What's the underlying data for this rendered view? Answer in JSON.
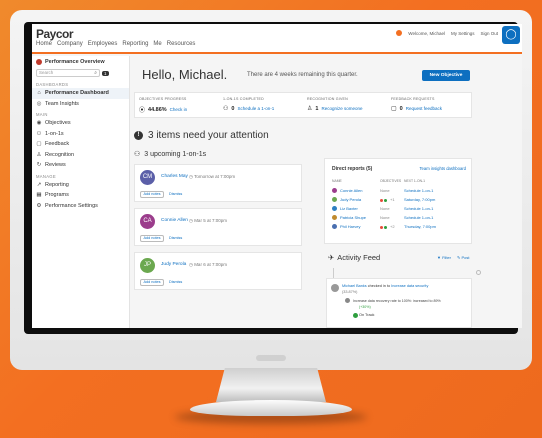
{
  "colors": {
    "brand": "#f36f21",
    "primary": "#0d6fc0",
    "on_track": "#2e9e3e"
  },
  "header": {
    "logo": "Paycor",
    "nav": [
      "Home",
      "Company",
      "Employees",
      "Reporting",
      "Me",
      "Resources"
    ],
    "welcome": "Welcome, Michael",
    "my_settings": "My Settings",
    "sign_out": "Sign Out"
  },
  "sidebar": {
    "app_title": "Performance Overview",
    "search_placeholder": "Search",
    "badge": "1",
    "sections": {
      "dashboards": "DASHBOARDS",
      "main": "MAIN",
      "manage": "MANAGE"
    },
    "items": [
      {
        "label": "Performance Dashboard",
        "icon": "home-icon"
      },
      {
        "label": "Team Insights",
        "icon": "compass-icon"
      },
      {
        "label": "Objectives",
        "icon": "target-icon"
      },
      {
        "label": "1-on-1s",
        "icon": "people-icon"
      },
      {
        "label": "Feedback",
        "icon": "chat-icon"
      },
      {
        "label": "Recognition",
        "icon": "award-icon"
      },
      {
        "label": "Reviews",
        "icon": "review-icon"
      },
      {
        "label": "Reporting",
        "icon": "chart-icon"
      },
      {
        "label": "Programs",
        "icon": "calendar-icon"
      },
      {
        "label": "Performance Settings",
        "icon": "gear-icon"
      }
    ]
  },
  "main": {
    "greeting": "Hello, Michael.",
    "subtitle": "There are 4 weeks remaining this quarter.",
    "new_objective": "New Objective",
    "stats": [
      {
        "label": "OBJECTIVES PROGRESS",
        "value": "44.86%",
        "link": "Check in"
      },
      {
        "label": "1-ON-1S COMPLETED",
        "value": "0",
        "link": "Schedule a 1-on-1"
      },
      {
        "label": "RECOGNITION GIVEN",
        "value": "1",
        "link": "Recognize someone"
      },
      {
        "label": "FEEDBACK REQUESTS",
        "value": "0",
        "link": "Request feedback"
      }
    ],
    "attention": "3 items need your attention",
    "attention_icon": "!",
    "upcoming": "3 upcoming 1-on-1s",
    "oneons": [
      {
        "initials": "CM",
        "color": "#5b5fa8",
        "name": "Charles May",
        "time": "Tomorrow at 7:00pm",
        "add_notes": "Add notes",
        "dismiss": "Dismiss"
      },
      {
        "initials": "CA",
        "color": "#9b3d8c",
        "name": "Connie Allen",
        "time": "Mar 5 at 7:00pm",
        "add_notes": "Add notes",
        "dismiss": "Dismiss"
      },
      {
        "initials": "JP",
        "color": "#6ba84f",
        "name": "Judy Perola",
        "time": "Mar 6 at 7:00pm",
        "add_notes": "Add notes",
        "dismiss": "Dismiss"
      }
    ],
    "direct_reports": {
      "title": "Direct reports (5)",
      "link": "Team insights dashboard",
      "headers": [
        "NAME",
        "OBJECTIVES",
        "NEXT 1-ON-1"
      ],
      "rows": [
        {
          "name": "Connie Allen",
          "objectives": "None",
          "next": "Schedule 1-on-1",
          "color": "#9b3d8c",
          "dots": []
        },
        {
          "name": "Judy Perola",
          "objectives": "+1",
          "next": "Saturday, 7:00pm",
          "color": "#6ba84f",
          "dots": [
            "#e74c3c",
            "#2e9e3e"
          ]
        },
        {
          "name": "Liz Baxter",
          "objectives": "None",
          "next": "Schedule 1-on-1",
          "color": "#2f7fc1",
          "dots": []
        },
        {
          "name": "Patricia Shupe",
          "objectives": "None",
          "next": "Schedule 1-on-1",
          "color": "#c08a2e",
          "dots": []
        },
        {
          "name": "Phil Harvey",
          "objectives": "+2",
          "next": "Thursday, 7:00pm",
          "color": "#4a6fb0",
          "dots": [
            "#e74c3c",
            "#2e9e3e"
          ]
        }
      ]
    },
    "activity": {
      "title": "Activity Feed",
      "filter": "Filter",
      "post": "Post",
      "item": {
        "author": "Michael Banks",
        "action": "checked in to",
        "target": "Increase data security",
        "progress": "(33.87%)",
        "detail": "Increase data recovery rate to 100%: increased to 89%",
        "delta": "(+30%)",
        "status": "On Track"
      }
    }
  }
}
